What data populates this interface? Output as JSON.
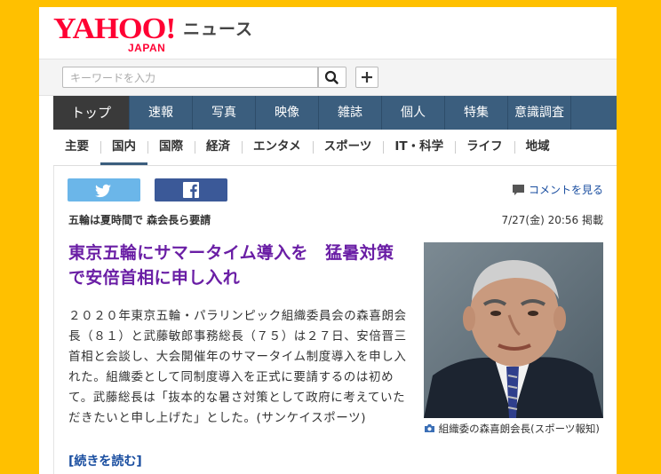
{
  "logo": {
    "brand": "YAHOO!",
    "region": "JAPAN",
    "section": "ニュース"
  },
  "search": {
    "placeholder": "キーワードを入力"
  },
  "nav_primary": [
    "トップ",
    "速報",
    "写真",
    "映像",
    "雑誌",
    "個人",
    "特集",
    "意識調査"
  ],
  "nav_secondary": [
    "主要",
    "国内",
    "国際",
    "経済",
    "エンタメ",
    "スポーツ",
    "IT・科学",
    "ライフ",
    "地域"
  ],
  "article": {
    "comment_link": "コメントを見る",
    "headline_small": "五輪は夏時間で 森会長ら要請",
    "date": "7/27(金) 20:56 掲載",
    "title": "東京五輪にサマータイム導入を　猛暑対策で安倍首相に申し入れ",
    "body": "２０２０年東京五輪・パラリンピック組織委員会の森喜朗会長（８１）と武藤敏郎事務総長（７５）は２７日、安倍晋三首相と会談し、大会開催年のサマータイム制度導入を申し入れた。組織委として同制度導入を正式に要請するのは初めて。武藤総長は「抜本的な暑さ対策として政府に考えていただきたいと申し上げた」とした。(サンケイスポーツ)",
    "more": "[続きを読む]",
    "photo_caption": "組織委の森喜朗会長(スポーツ報知)"
  },
  "colors": {
    "background": "#ffc000",
    "nav": "#3b5e7e",
    "title": "#6a1ea5",
    "brand": "#ff0033"
  }
}
